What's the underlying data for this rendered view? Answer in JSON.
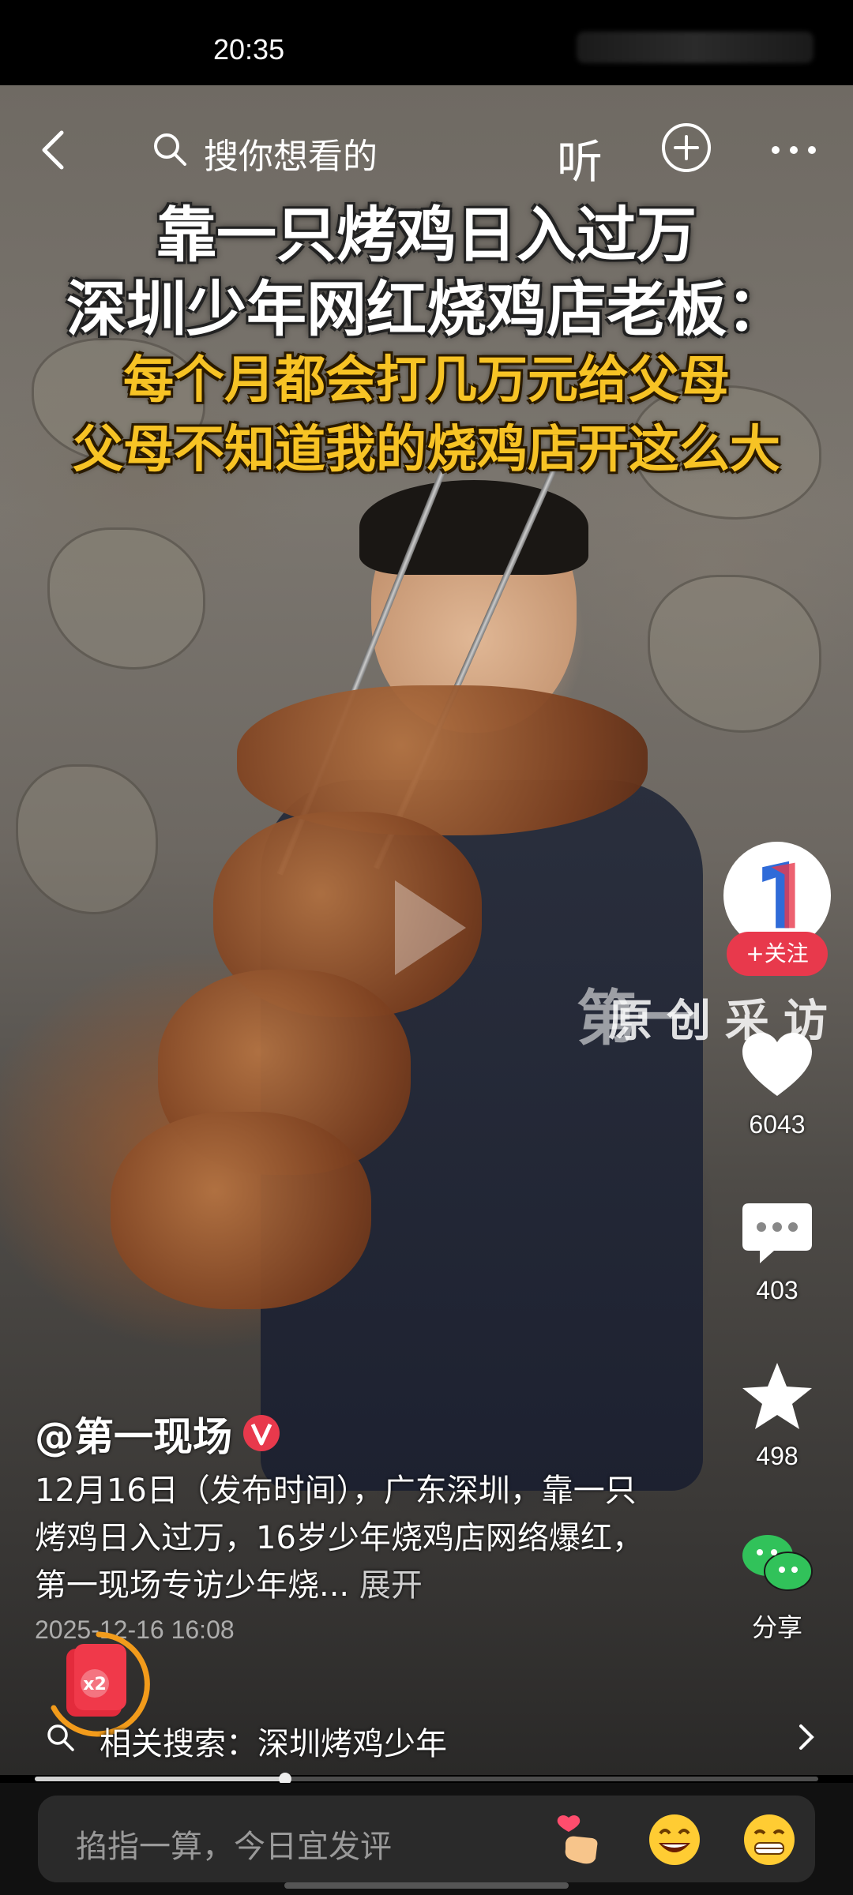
{
  "status_bar": {
    "time": "20:35"
  },
  "top_nav": {
    "search_placeholder": "搜你想看的",
    "listen_label": "听"
  },
  "headline": {
    "line1": "靠一只烤鸡日入过万",
    "line2": "深圳少年网红烧鸡店老板：",
    "line3": "每个月都会打几万元给父母",
    "line4": "父母不知道我的烧鸡店开这么大"
  },
  "watermark": {
    "logo_text": "第一",
    "caption": "原创采访"
  },
  "actions": {
    "follow_label": "+关注",
    "likes": "6043",
    "comments": "403",
    "favorites": "498",
    "share_label": "分享"
  },
  "post": {
    "author": "@第一现场",
    "description": "12月16日（发布时间），广东深圳，靠一只烤鸡日入过万，16岁少年烧鸡店网络爆红，第一现场专访少年烧...",
    "expand_label": "展开",
    "date": "2025-12-16 16:08"
  },
  "redpacket": {
    "badge": "x2"
  },
  "related": {
    "text": "相关搜索：深圳烤鸡少年"
  },
  "playback": {
    "progress_fraction": 0.32
  },
  "comment_bar": {
    "placeholder": "掐指一算，今日宜发评"
  },
  "colors": {
    "headline_yellow": "#f7c325",
    "follow_red": "#e8394c",
    "verified_red": "#e8394c"
  },
  "icons": [
    "back-icon",
    "search-icon",
    "add-icon",
    "more-icon",
    "play-icon",
    "heart-icon",
    "comment-icon",
    "star-icon",
    "wechat-share-icon",
    "verified-icon",
    "redpacket-icon",
    "chevron-right-icon",
    "emoji-heart-hand",
    "emoji-laugh",
    "emoji-grin"
  ]
}
